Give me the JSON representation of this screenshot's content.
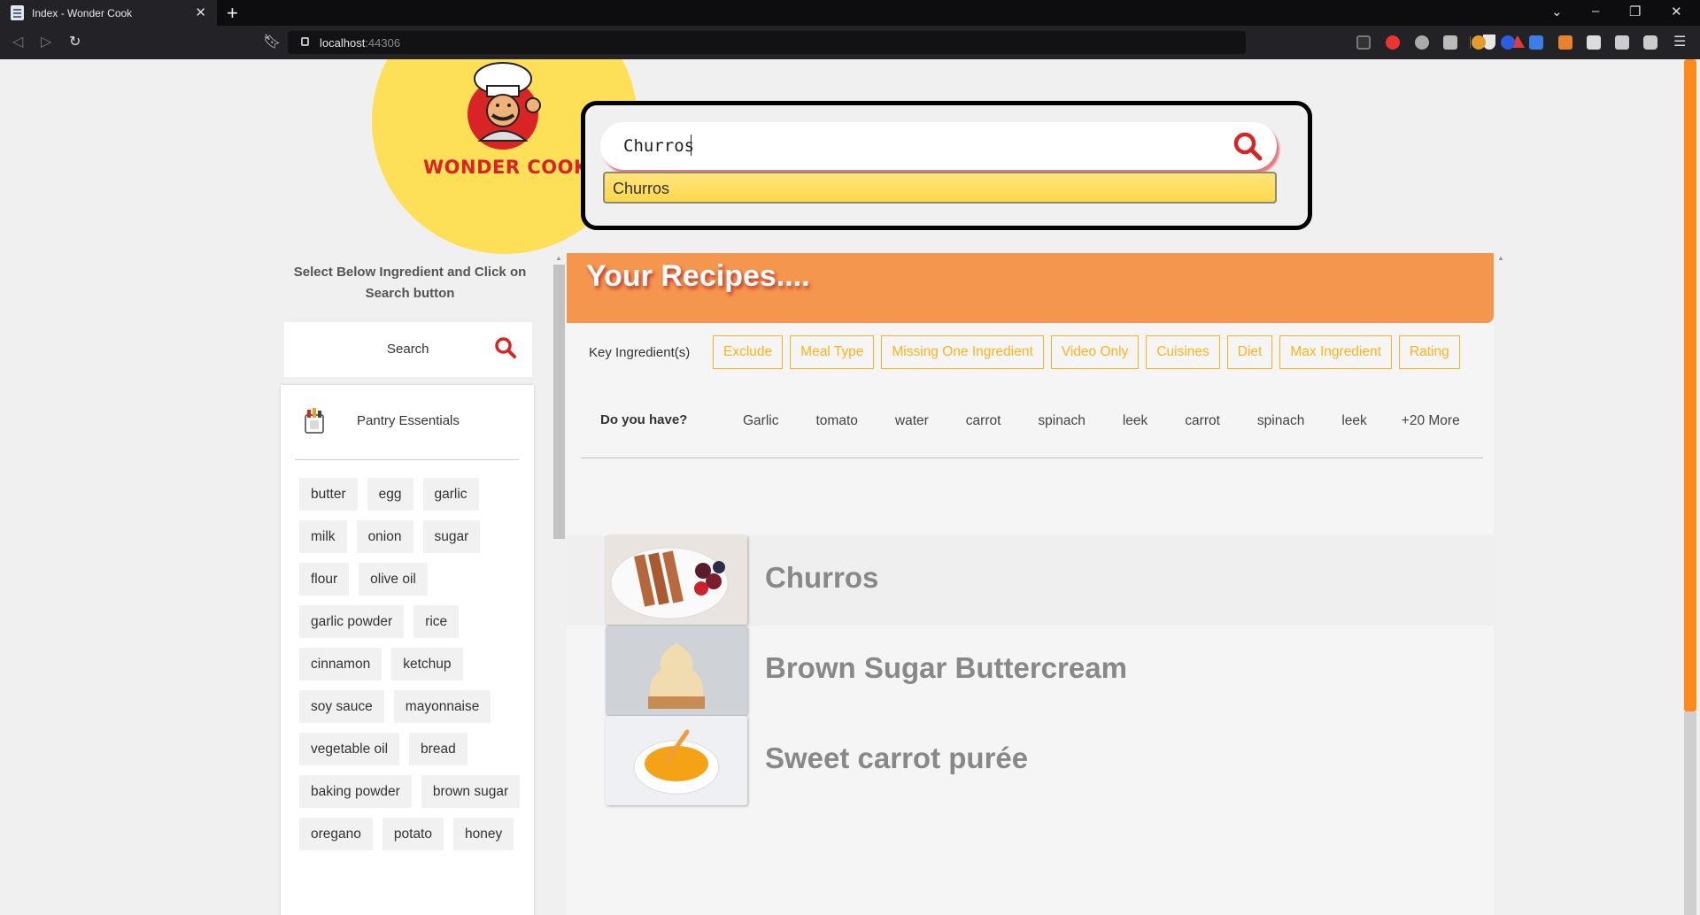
{
  "browser": {
    "tab_title": "Index - Wonder Cook",
    "url_host": "localhost",
    "url_port": ":44306"
  },
  "brand": {
    "logo_text": "WONDER COOK"
  },
  "search": {
    "value": "Churros",
    "suggestion": "Churros"
  },
  "sidebar": {
    "heading": "Select Below Ingredient and Click on Search button",
    "search_label": "Search",
    "category": "Pantry Essentials",
    "ingredients": [
      "butter",
      "egg",
      "garlic",
      "milk",
      "onion",
      "sugar",
      "flour",
      "olive oil",
      "garlic powder",
      "rice",
      "cinnamon",
      "ketchup",
      "soy sauce",
      "mayonnaise",
      "vegetable oil",
      "bread",
      "baking powder",
      "brown sugar",
      "oregano",
      "potato",
      "honey"
    ]
  },
  "main": {
    "title": "Your Recipes....",
    "filter_label": "Key Ingredient(s)",
    "filters": [
      "Exclude",
      "Meal Type",
      "Missing One Ingredient",
      "Video Only",
      "Cuisines",
      "Diet",
      "Max Ingredient",
      "Rating"
    ],
    "have_label": "Do you have?",
    "have_items": [
      "Garlic",
      "tomato",
      "water",
      "carrot",
      "spinach",
      "leek",
      "carrot",
      "spinach",
      "leek",
      "+20 More"
    ],
    "recipes": [
      "Churros",
      "Brown Sugar Buttercream",
      "Sweet carrot purée"
    ]
  },
  "colors": {
    "accent_orange": "#f5964f",
    "filter_yellow": "#ffb21a",
    "logo_yellow": "#fedf58",
    "brand_red": "#d82424"
  }
}
